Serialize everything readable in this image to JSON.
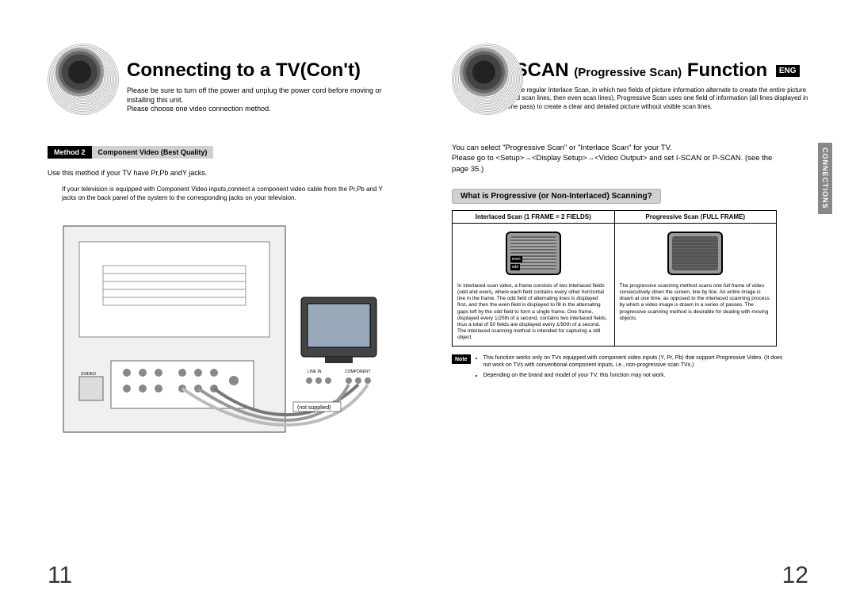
{
  "left": {
    "title": "Connecting to a TV(Con't)",
    "intro_line1": "Please be sure to turn off the power and unplug the power cord before moving or installing this unit.",
    "intro_line2": "Please choose one video connection method.",
    "method_label": "Method 2",
    "method_title": "Component Video (Best Quality)",
    "method_desc": "Use this method if your TV have Pr,Pb andY jacks.",
    "method_body": "If your television is equipped with Component Video inputs,connect a component video cable from the Pr,Pb and Y jacks on the back panel of the system to the corresponding jacks on your television.",
    "diagram_not_supplied": "(not supplied)",
    "diagram_linein": "LINE IN",
    "diagram_component": "COMPONENT",
    "diagram_svideo": "SVIDEO",
    "pagenum": "11"
  },
  "right": {
    "title_prefix": "P.SCAN",
    "title_small": "(Progressive Scan)",
    "title_suffix": "Function",
    "eng": "ENG",
    "intro": "Unlike regular Interlace Scan, in which two fields of picture information alternate to create the entire picture (odd scan lines, then even scan lines), Progressive Scan uses one field of information (all lines displayed in one pass) to create a clear and detailed picture without visible scan lines.",
    "side_tab": "CONNECTIONS",
    "body_line1": "You can select \"Progressive Scan\" or \"Interlace Scan\" for your TV.",
    "body_line2": "Please go to <Setup>→<Display Setup>→<Video Output> and set I-SCAN or P-SCAN. (see the page 35.)",
    "question": "What is Progressive (or Non-Interlaced) Scanning?",
    "col1_header": "Interlaced Scan (1 FRAME = 2 FIELDS)",
    "col2_header": "Progressive Scan (FULL FRAME)",
    "scan_even": "even",
    "scan_odd": "odd",
    "col1_text": "In interlaced-scan video, a frame consists of two interlaced fields (odd and even), where each field contains every other horizontal line in the frame. The odd field of alternating lines is displayed first, and then the even field is displayed to fill in the alternating gaps left by the odd field to form a single frame. One frame, displayed every 1/25th of a second, contains two interlaced fields, thus a total of 50 fields are displayed every 1/50th of a second. The interlaced scanning method is intended for capturing a still object.",
    "col2_text": "The progressive scanning method scans one full frame of video consecutively down the screen, line by line. An entire image is drawn at one time, as opposed to the interlaced scanning process by which a video image is drawn in a series of passes. The progressive scanning method is desirable for dealing with moving objects.",
    "note_label": "Note",
    "note1": "This function works only on TVs equipped with component video inputs (Y, Pr, Pb) that support Progressive Video. (It does not work on TVs with conventional component inputs, i.e., non-progressive scan TVs.)",
    "note2": "Depending on the brand and model of your TV, this function may not work.",
    "pagenum": "12"
  }
}
